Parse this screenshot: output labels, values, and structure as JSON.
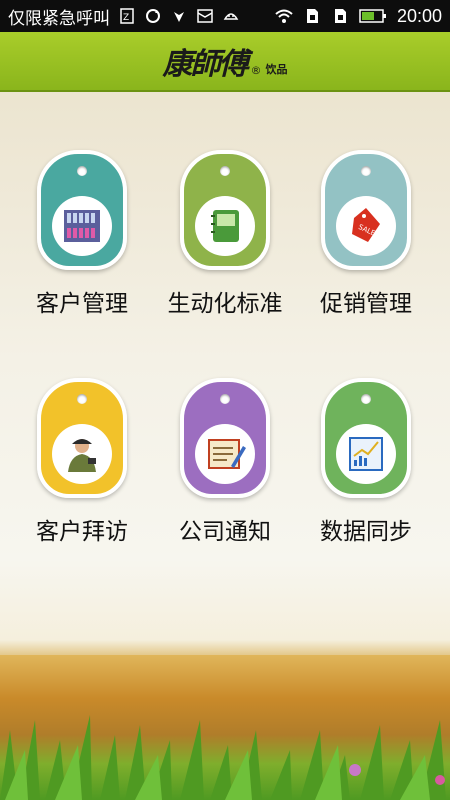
{
  "status_bar": {
    "carrier_text": "仅限紧急呼叫",
    "time": "20:00",
    "icons": [
      "sim-icon",
      "sync-icon",
      "huawei-icon",
      "mail-icon",
      "android-icon",
      "wifi-icon",
      "sim-card-icon",
      "sim-card-icon",
      "battery-icon"
    ]
  },
  "header": {
    "brand": "康師傅",
    "registered": "®",
    "sub": "饮品"
  },
  "menu": [
    {
      "label": "客户管理",
      "color": "#4aa8a0",
      "icon": "shelf-icon"
    },
    {
      "label": "生动化标准",
      "color": "#8fb34a",
      "icon": "notebook-icon"
    },
    {
      "label": "促销管理",
      "color": "#93c2c4",
      "icon": "sale-tag-icon"
    },
    {
      "label": "客户拜访",
      "color": "#f2c22a",
      "icon": "salesman-icon"
    },
    {
      "label": "公司通知",
      "color": "#9c6ec0",
      "icon": "notice-icon"
    },
    {
      "label": "数据同步",
      "color": "#6fb35c",
      "icon": "chart-icon"
    }
  ]
}
